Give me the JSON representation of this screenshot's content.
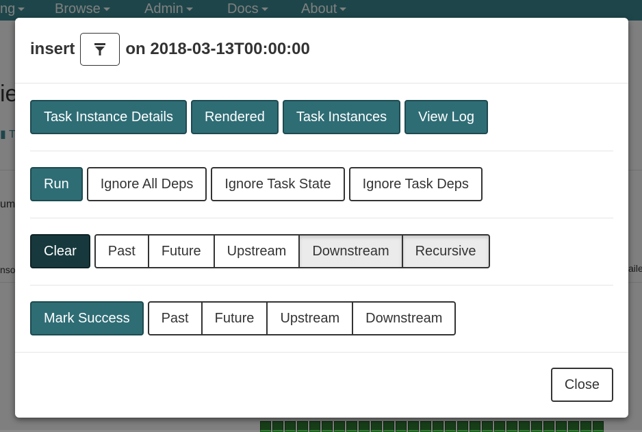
{
  "background": {
    "nav": [
      "ng",
      "Browse",
      "Admin",
      "Docs",
      "About"
    ],
    "heading_fragment": "ie",
    "tab_fragment": "T",
    "left_fragment_1": "um",
    "left_fragment_2": "nso",
    "right_fragment": "aile"
  },
  "modal": {
    "task_id": "insert",
    "on_text": "on",
    "execution_date": "2018-03-13T00:00:00",
    "links": [
      "Task Instance Details",
      "Rendered",
      "Task Instances",
      "View Log"
    ],
    "run": {
      "label": "Run",
      "options": [
        "Ignore All Deps",
        "Ignore Task State",
        "Ignore Task Deps"
      ]
    },
    "clear": {
      "label": "Clear",
      "options": [
        "Past",
        "Future",
        "Upstream",
        "Downstream",
        "Recursive"
      ]
    },
    "mark_success": {
      "label": "Mark Success",
      "options": [
        "Past",
        "Future",
        "Upstream",
        "Downstream"
      ]
    },
    "close_label": "Close"
  },
  "colors": {
    "navbar": "#3d8d95",
    "primary_button": "#2f6d75",
    "clear_button": "#17393d"
  }
}
